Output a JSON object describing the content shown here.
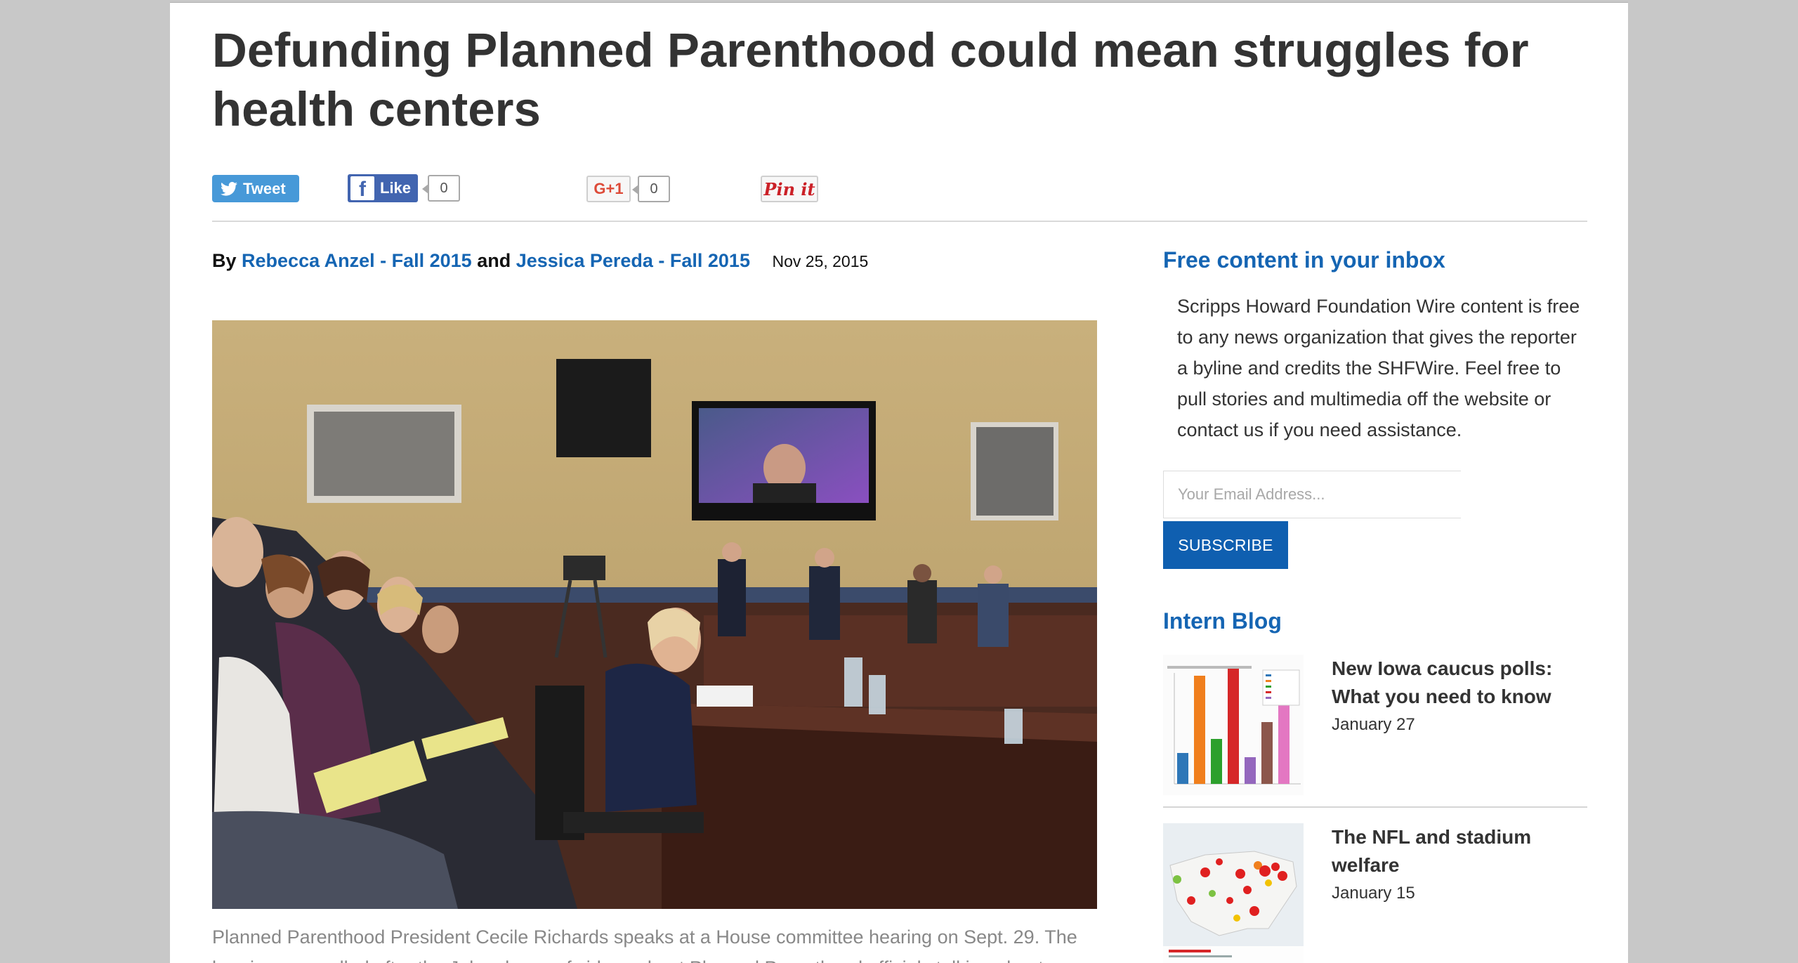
{
  "article": {
    "title": "Defunding Planned Parenthood could mean struggles for health centers",
    "by_label": "By",
    "author1": "Rebecca Anzel - Fall 2015",
    "and_label": "and",
    "author2": "Jessica Pereda - Fall 2015",
    "date": "Nov 25, 2015",
    "caption": "Planned Parenthood President Cecile Richards speaks at a House committee hearing on Sept. 29. The hearing was called after the July release of videos about Planned Parenthood officials talking about"
  },
  "social": {
    "tweet_label": "Tweet",
    "like_label": "Like",
    "like_count": "0",
    "gplus_label": "G+1",
    "gplus_count": "0",
    "pin_label": "Pin it"
  },
  "sidebar": {
    "newsletter_heading": "Free content in your inbox",
    "newsletter_text": "Scripps Howard Foundation Wire content is free to any news organization that gives the reporter a byline and credits the SHFWire. Feel free to pull stories and multimedia off the website or contact us if you need assistance.",
    "email_placeholder": "Your Email Address...",
    "subscribe_label": "SUBSCRIBE",
    "blog_heading": "Intern Blog",
    "posts": [
      {
        "title": "New Iowa caucus polls: What you need to know",
        "date": "January 27"
      },
      {
        "title": "The NFL and stadium welfare",
        "date": "January 15"
      }
    ]
  },
  "colors": {
    "link": "#1565b3",
    "subscribe_bg": "#0f5fb0",
    "twitter": "#4799d8",
    "facebook": "#4265b0"
  }
}
